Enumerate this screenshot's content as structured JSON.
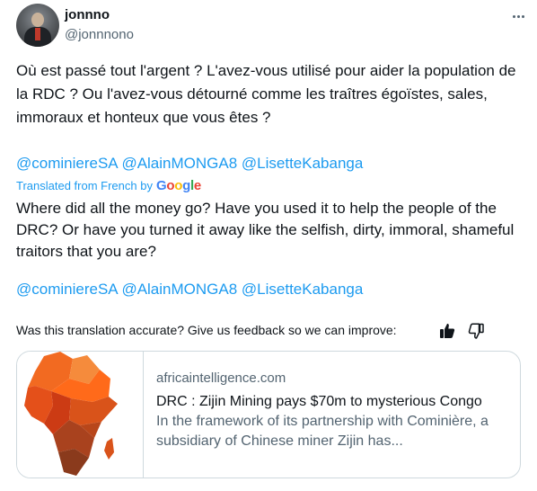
{
  "tweet": {
    "author_name": "jonnno",
    "author_handle": "@jonnnono",
    "original_text": "Où est passé tout l'argent ? L'avez-vous utilisé pour aider la population de la RDC ? Ou l'avez-vous détourné comme les traîtres égoïstes, sales, immoraux et honteux que vous êtes ?",
    "mentions": [
      "@cominiereSA",
      "@AlainMONGA8",
      "@LisetteKabanga"
    ],
    "translated_label": "Translated from French by",
    "translated_by": "Google",
    "translation_text": "Where did all the money go? Have you used it to help the people of the DRC? Or have you turned it away like the selfish, dirty, immoral, shameful traitors that you are?",
    "feedback_text": "Was this translation accurate? Give us feedback so we can improve:"
  },
  "link_card": {
    "domain": "africaintelligence.com",
    "title": "DRC : Zijin Mining pays $70m to mysterious Congo",
    "description": "In the framework of its partnership with Cominière, a subsidiary of Chinese miner Zijin has..."
  },
  "icons": {
    "more": "more-icon",
    "thumb_up": "thumbs-up-icon",
    "thumb_down": "thumbs-down-icon"
  },
  "colors": {
    "link": "#1d9bf0",
    "text": "#0f1419",
    "secondary": "#536471",
    "border": "#cfd9de",
    "africa_orange": "#f26a21"
  }
}
